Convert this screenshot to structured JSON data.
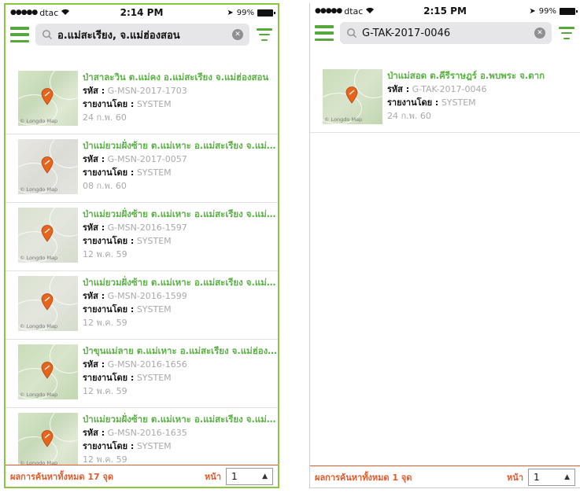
{
  "screens": [
    {
      "status": {
        "carrier": "dtac",
        "time": "2:14 PM",
        "battery": "99%"
      },
      "search": {
        "value": "อ.แม่สะเรียง, จ.แม่ฮ่องสอน"
      },
      "labels": {
        "code": "รหัส :",
        "reporter": "รายงานโดย :"
      },
      "items": [
        {
          "title": "ป่าสาละวิน ต.แม่คง อ.แม่สะเรียง จ.แม่ฮ่องสอน",
          "code": "G-MSN-2017-1703",
          "reporter": "SYSTEM",
          "date": "24 ก.พ. 60",
          "map_credit": "© Longdo Map"
        },
        {
          "title": "ป่าแม่ยวมฝั่งซ้าย ต.แม่เหาะ อ.แม่สะเรียง จ.แม่ฮ่องสอน",
          "code": "G-MSN-2017-0057",
          "reporter": "SYSTEM",
          "date": "08 ก.พ. 60",
          "map_credit": "© Longdo Map"
        },
        {
          "title": "ป่าแม่ยวมฝั่งซ้าย ต.แม่เหาะ อ.แม่สะเรียง จ.แม่ฮ่องสอน",
          "code": "G-MSN-2016-1597",
          "reporter": "SYSTEM",
          "date": "12 พ.ค. 59",
          "map_credit": "© Longdo Map"
        },
        {
          "title": "ป่าแม่ยวมฝั่งซ้าย ต.แม่เหาะ อ.แม่สะเรียง จ.แม่ฮ่องสอน",
          "code": "G-MSN-2016-1599",
          "reporter": "SYSTEM",
          "date": "12 พ.ค. 59",
          "map_credit": "© Longdo Map"
        },
        {
          "title": "ป่าขุนแม่ลาย ต.แม่เหาะ อ.แม่สะเรียง จ.แม่ฮ่องสอน",
          "code": "G-MSN-2016-1656",
          "reporter": "SYSTEM",
          "date": "12 พ.ค. 59",
          "map_credit": "© Longdo Map"
        },
        {
          "title": "ป่าแม่ยวมฝั่งซ้าย ต.แม่เหาะ อ.แม่สะเรียง จ.แม่ฮ่องสอน",
          "code": "G-MSN-2016-1635",
          "reporter": "SYSTEM",
          "date": "12 พ.ค. 59",
          "map_credit": "© Longdo Map"
        }
      ],
      "footer": {
        "total": "ผลการค้นหาทั้งหมด 17 จุด",
        "page_label": "หน้า",
        "page_value": "1"
      }
    },
    {
      "status": {
        "carrier": "dtac",
        "time": "2:15 PM",
        "battery": "99%"
      },
      "search": {
        "value": "G-TAK-2017-0046"
      },
      "labels": {
        "code": "รหัส :",
        "reporter": "รายงานโดย :"
      },
      "items": [
        {
          "title": "ป่าแม่สอด ต.คีรีราษฎร์ อ.พบพระ จ.ตาก",
          "code": "G-TAK-2017-0046",
          "reporter": "SYSTEM",
          "date": "24 ก.พ. 60",
          "map_credit": "© Longdo Map"
        }
      ],
      "footer": {
        "total": "ผลการค้นหาทั้งหมด 1 จุด",
        "page_label": "หน้า",
        "page_value": "1"
      }
    }
  ],
  "colors": {
    "accent_green": "#57a83b",
    "title_green": "#5ab144",
    "footer_orange": "#e05a2b",
    "pin_orange": "#e8641b"
  },
  "icons": {
    "menu": "hamburger-icon",
    "search": "magnifier-icon",
    "clear": "clear-circle-icon",
    "filter": "filter-icon",
    "pin": "map-pin-icon",
    "caret": "caret-up-icon"
  }
}
